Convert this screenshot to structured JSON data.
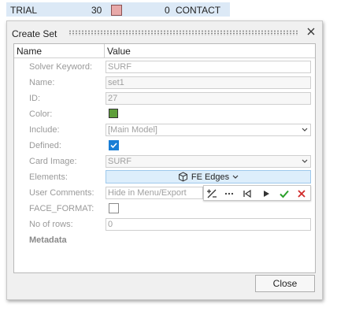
{
  "background_row": {
    "name": "TRIAL",
    "count": "30",
    "value": "0",
    "type": "CONTACT",
    "swatch_color": "#e8a9a9"
  },
  "dialog": {
    "title": "Create Set",
    "close_icon": "close-icon",
    "columns": {
      "name": "Name",
      "value": "Value"
    },
    "rows": {
      "solver_keyword": {
        "label": "Solver Keyword:",
        "value": "SURF"
      },
      "name": {
        "label": "Name:",
        "value": "set1"
      },
      "id": {
        "label": "ID:",
        "value": "27"
      },
      "color": {
        "label": "Color:",
        "value": "#5e9e3a"
      },
      "include": {
        "label": "Include:",
        "value": "[Main Model]"
      },
      "defined": {
        "label": "Defined:",
        "checked": true
      },
      "card_image": {
        "label": "Card Image:",
        "value": "SURF"
      },
      "elements": {
        "label": "Elements:",
        "button_label": "FE Edges",
        "icon": "cube-icon"
      },
      "user_comments": {
        "label": "User Comments:",
        "value": "Hide in Menu/Export"
      },
      "face_format": {
        "label": "FACE_FORMAT:",
        "checked": false
      },
      "no_of_rows": {
        "label": "No of rows:",
        "value": "0"
      },
      "metadata": {
        "label": "Metadata"
      }
    },
    "toolbar_icons": [
      "plus-minus-icon",
      "more-icon",
      "skip-back-icon",
      "play-icon",
      "check-icon",
      "close-icon"
    ],
    "close_button": "Close"
  },
  "colors": {
    "accent": "#1a7ed6",
    "confirm": "#2aa02a",
    "cancel": "#d12a2a",
    "row_highlight": "#dce9f6"
  }
}
